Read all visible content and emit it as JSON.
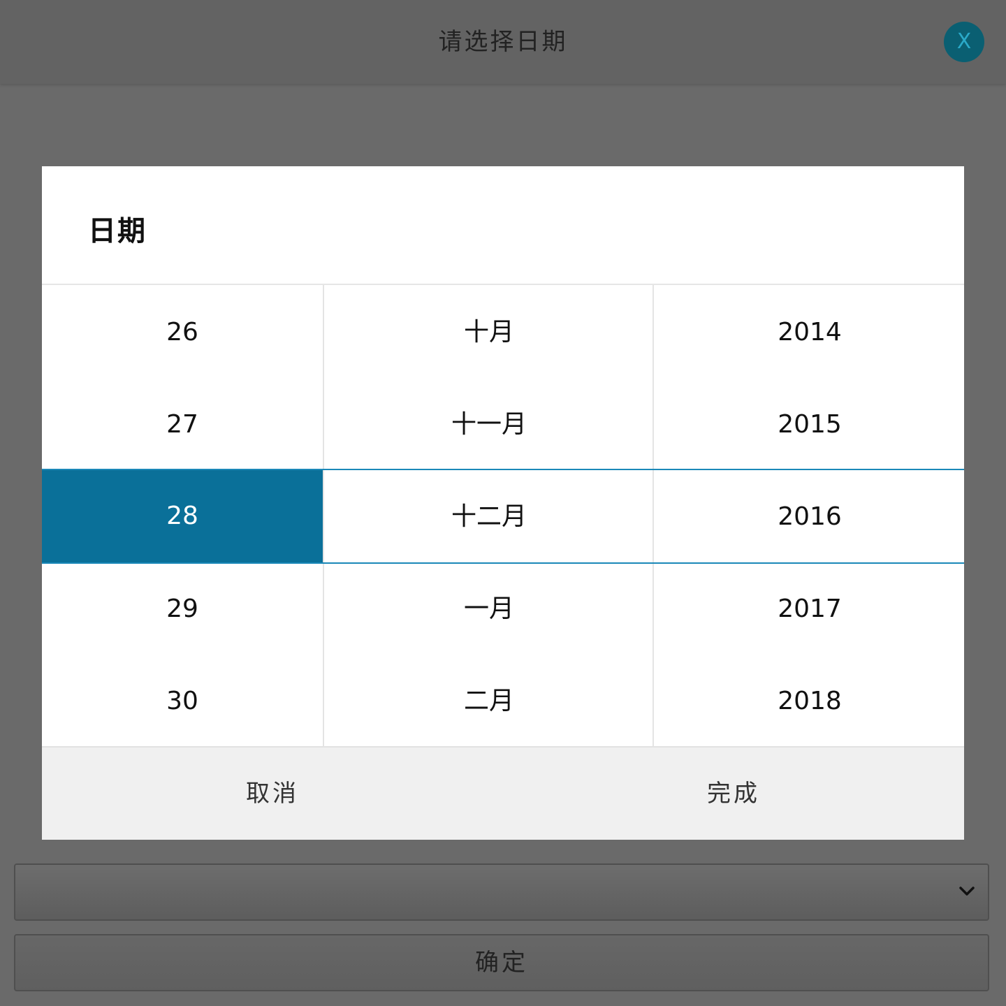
{
  "header": {
    "title": "请选择日期",
    "close_label": "X"
  },
  "dialog": {
    "title": "日期",
    "days": [
      "26",
      "27",
      "28",
      "29",
      "30"
    ],
    "months": [
      "十月",
      "十一月",
      "十二月",
      "一月",
      "二月"
    ],
    "years": [
      "2014",
      "2015",
      "2016",
      "2017",
      "2018"
    ],
    "selected": {
      "day": "28",
      "month": "十二月",
      "year": "2016"
    },
    "cancel_label": "取消",
    "done_label": "完成"
  },
  "form": {
    "select_value": "",
    "confirm_label": "确定"
  },
  "colors": {
    "accent": "#0a7099",
    "selection_line": "#1a88b8",
    "close_button": "#0a5f72",
    "overlay": "#6a6a6a"
  },
  "icons": {
    "close": "close-icon",
    "select": "chevron-down-icon"
  }
}
